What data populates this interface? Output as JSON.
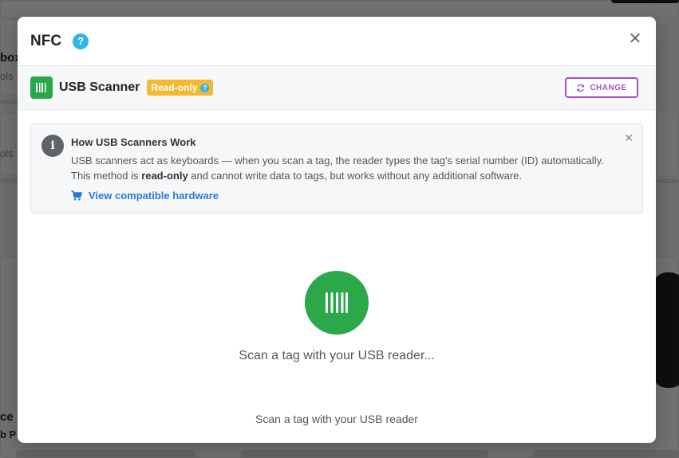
{
  "background": {
    "fragments": [
      "box",
      "ols",
      "ols",
      "ce",
      "b P"
    ]
  },
  "modal": {
    "title": "NFC",
    "help_icon": "question-circle-icon",
    "close_icon": "close-icon"
  },
  "method": {
    "name": "USB Scanner",
    "icon": "barcode-icon",
    "badge": "Read-only",
    "change_label": "CHANGE"
  },
  "info": {
    "title": "How USB Scanners Work",
    "line1": "USB scanners act as keyboards — when you scan a tag, the reader types the tag's serial number (ID) automatically.",
    "line2_pre": "This method is ",
    "line2_bold": "read-only",
    "line2_post": " and cannot write data to tags, but works without any additional software.",
    "link": "View compatible hardware",
    "link_icon": "cart-icon"
  },
  "scan": {
    "prompt": "Scan a tag with your USB reader...",
    "hint": "Scan a tag with your USB reader"
  },
  "colors": {
    "green": "#2aa84a",
    "purple": "#a44fc3",
    "badge": "#f5b82e",
    "link": "#2a7bd4",
    "help": "#2fb6e8"
  }
}
